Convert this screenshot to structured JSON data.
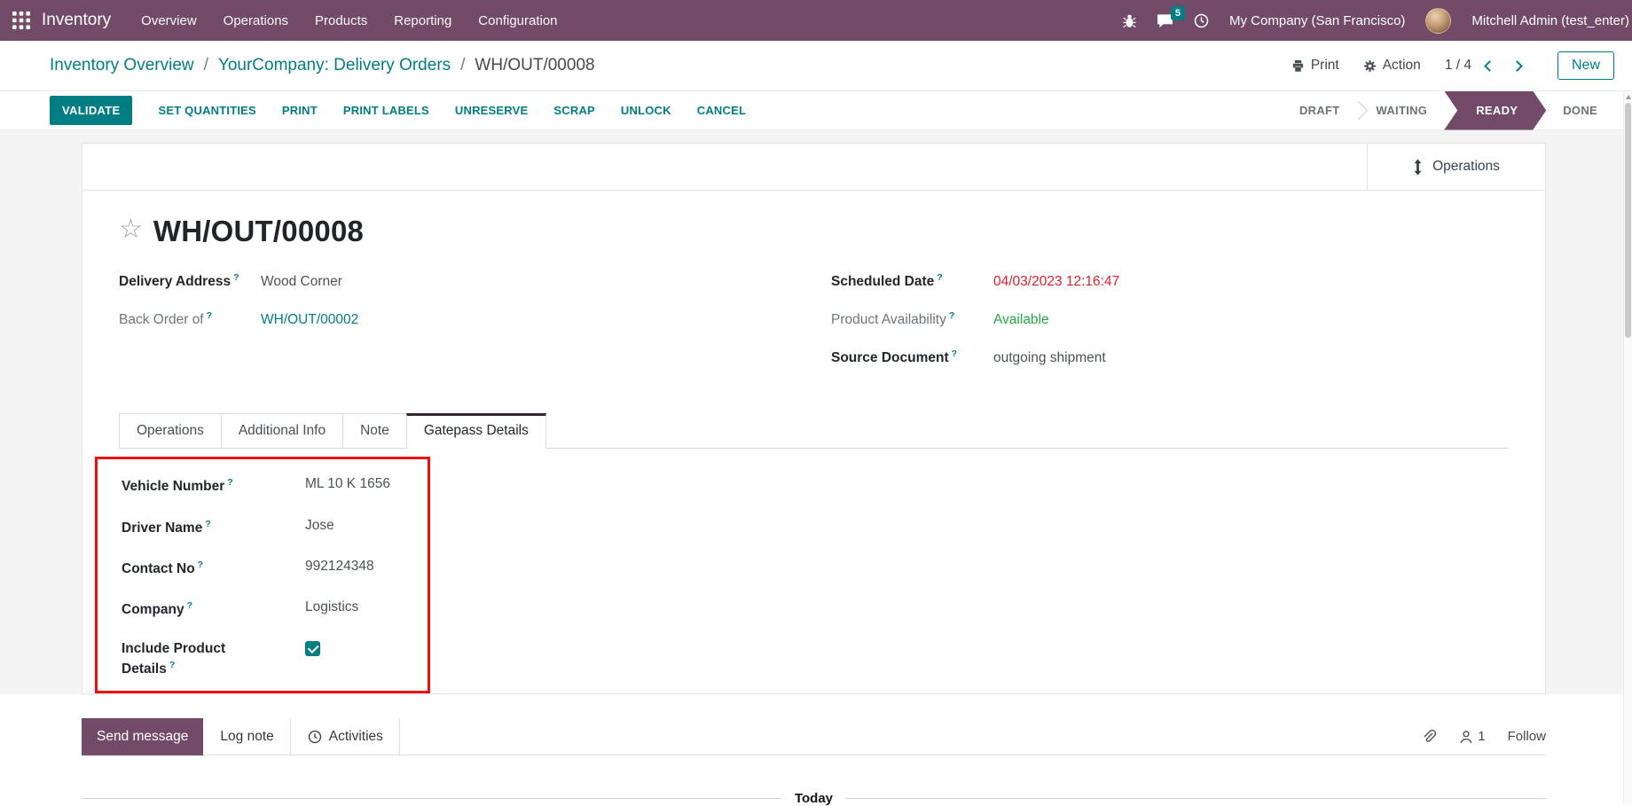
{
  "colors": {
    "brand": "#714B67",
    "primary": "#017E84",
    "danger": "#e41e2d",
    "success": "#28a745",
    "annotation": "#ec0f0f"
  },
  "navbar": {
    "app_name": "Inventory",
    "menus": [
      "Overview",
      "Operations",
      "Products",
      "Reporting",
      "Configuration"
    ],
    "systray": {
      "message_badge": "5",
      "company": "My Company (San Francisco)",
      "user": "Mitchell Admin (test_enter)"
    }
  },
  "breadcrumb": {
    "parents": [
      "Inventory Overview",
      "YourCompany: Delivery Orders"
    ],
    "current": "WH/OUT/00008",
    "separator": "/"
  },
  "actions": {
    "print": "Print",
    "action": "Action",
    "pager": "1 / 4",
    "new": "New"
  },
  "statusbar": {
    "buttons": [
      "VALIDATE",
      "SET QUANTITIES",
      "PRINT",
      "PRINT LABELS",
      "UNRESERVE",
      "SCRAP",
      "UNLOCK",
      "CANCEL"
    ],
    "stages": [
      "DRAFT",
      "WAITING",
      "READY",
      "DONE"
    ],
    "active_stage": "READY"
  },
  "form": {
    "button_box": {
      "operations": "Operations"
    },
    "star_glyph": "☆",
    "title": "WH/OUT/00008",
    "help_mark": "?",
    "left_fields": {
      "delivery_address": {
        "label": "Delivery Address",
        "value": "Wood Corner"
      },
      "back_order_of": {
        "label": "Back Order of",
        "value": "WH/OUT/00002"
      }
    },
    "right_fields": {
      "scheduled_date": {
        "label": "Scheduled Date",
        "value": "04/03/2023 12:16:47"
      },
      "product_availability": {
        "label": "Product Availability",
        "value": "Available"
      },
      "source_document": {
        "label": "Source Document",
        "value": "outgoing shipment"
      }
    },
    "tabs": [
      "Operations",
      "Additional Info",
      "Note",
      "Gatepass Details"
    ],
    "active_tab": "Gatepass Details",
    "gatepass": {
      "vehicle_number": {
        "label": "Vehicle Number",
        "value": "ML 10 K 1656"
      },
      "driver_name": {
        "label": "Driver Name",
        "value": "Jose"
      },
      "contact_no": {
        "label": "Contact No",
        "value": "992124348"
      },
      "company": {
        "label": "Company",
        "value": "Logistics"
      },
      "include_product_details": {
        "label": "Include Product Details",
        "checked": true
      }
    }
  },
  "chatter": {
    "send_message": "Send message",
    "log_note": "Log note",
    "activities": "Activities",
    "follower_count": "1",
    "follow": "Follow",
    "date_divider": "Today"
  }
}
